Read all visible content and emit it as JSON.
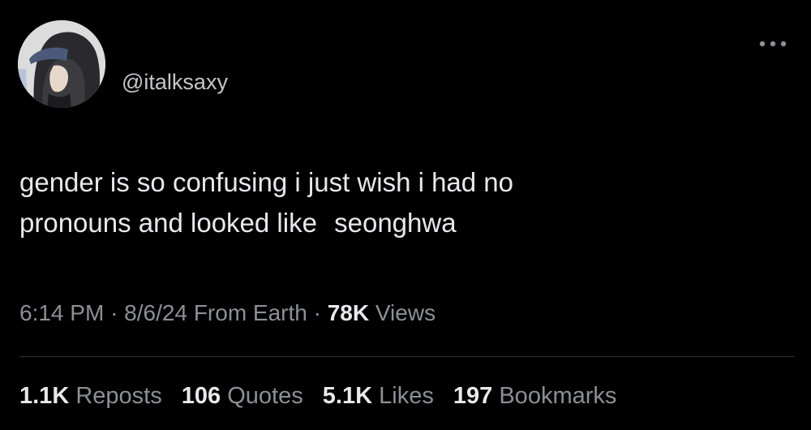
{
  "tweet": {
    "handle": "@italksaxy",
    "avatar_icon": "user-avatar-hooded-figure",
    "more_icon": "more-options-icon",
    "text_line1": "gender is so confusing i just wish i had no",
    "text_line2_part1": "pronouns and looked like",
    "text_line2_part2": "seonghwa",
    "time": "6:14 PM",
    "separator": "·",
    "date": "8/6/24",
    "source": "From Earth",
    "views_count": "78K",
    "views_label": "Views"
  },
  "stats": {
    "reposts_count": "1.1K",
    "reposts_label": "Reposts",
    "quotes_count": "106",
    "quotes_label": "Quotes",
    "likes_count": "5.1K",
    "likes_label": "Likes",
    "bookmarks_count": "197",
    "bookmarks_label": "Bookmarks"
  },
  "colors": {
    "background": "#000000",
    "primary_text": "#e7e9ea",
    "secondary_text": "#8b9096",
    "divider": "#2f3336"
  }
}
